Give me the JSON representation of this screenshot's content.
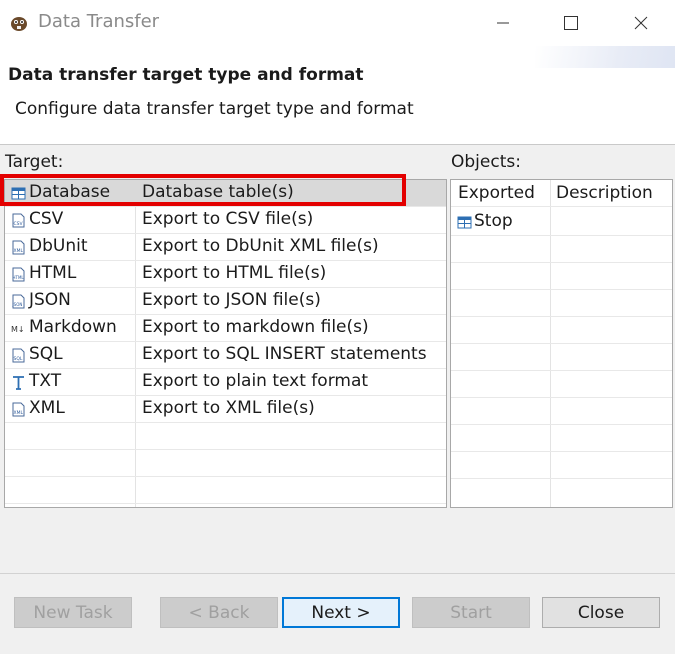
{
  "window": {
    "title": "Data Transfer"
  },
  "header": {
    "title": "Data transfer target type and format",
    "description": "Configure data transfer target type and format"
  },
  "target": {
    "label": "Target:",
    "items": [
      {
        "name": "Database",
        "description": "Database table(s)",
        "icon": "database-table-icon",
        "selected": true
      },
      {
        "name": "CSV",
        "description": "Export to CSV file(s)",
        "icon": "csv-file-icon"
      },
      {
        "name": "DbUnit",
        "description": "Export to DbUnit XML file(s)",
        "icon": "xml-file-icon"
      },
      {
        "name": "HTML",
        "description": "Export to HTML file(s)",
        "icon": "html-file-icon"
      },
      {
        "name": "JSON",
        "description": "Export to JSON file(s)",
        "icon": "json-file-icon"
      },
      {
        "name": "Markdown",
        "description": "Export to markdown file(s)",
        "icon": "markdown-icon"
      },
      {
        "name": "SQL",
        "description": "Export to SQL INSERT statements",
        "icon": "sql-file-icon"
      },
      {
        "name": "TXT",
        "description": "Export to plain text format",
        "icon": "text-icon"
      },
      {
        "name": "XML",
        "description": "Export to XML file(s)",
        "icon": "xml-file-icon"
      }
    ]
  },
  "objects": {
    "label": "Objects:",
    "columns": [
      "Exported",
      "Description"
    ],
    "items": [
      {
        "name": "Stop",
        "icon": "table-icon"
      }
    ]
  },
  "buttons": {
    "new_task": "New Task",
    "back": "< Back",
    "next": "Next >",
    "start": "Start",
    "close": "Close"
  },
  "colors": {
    "highlight": "#e30000",
    "selection": "#d9d9d9",
    "default_button_border": "#0078d7"
  }
}
